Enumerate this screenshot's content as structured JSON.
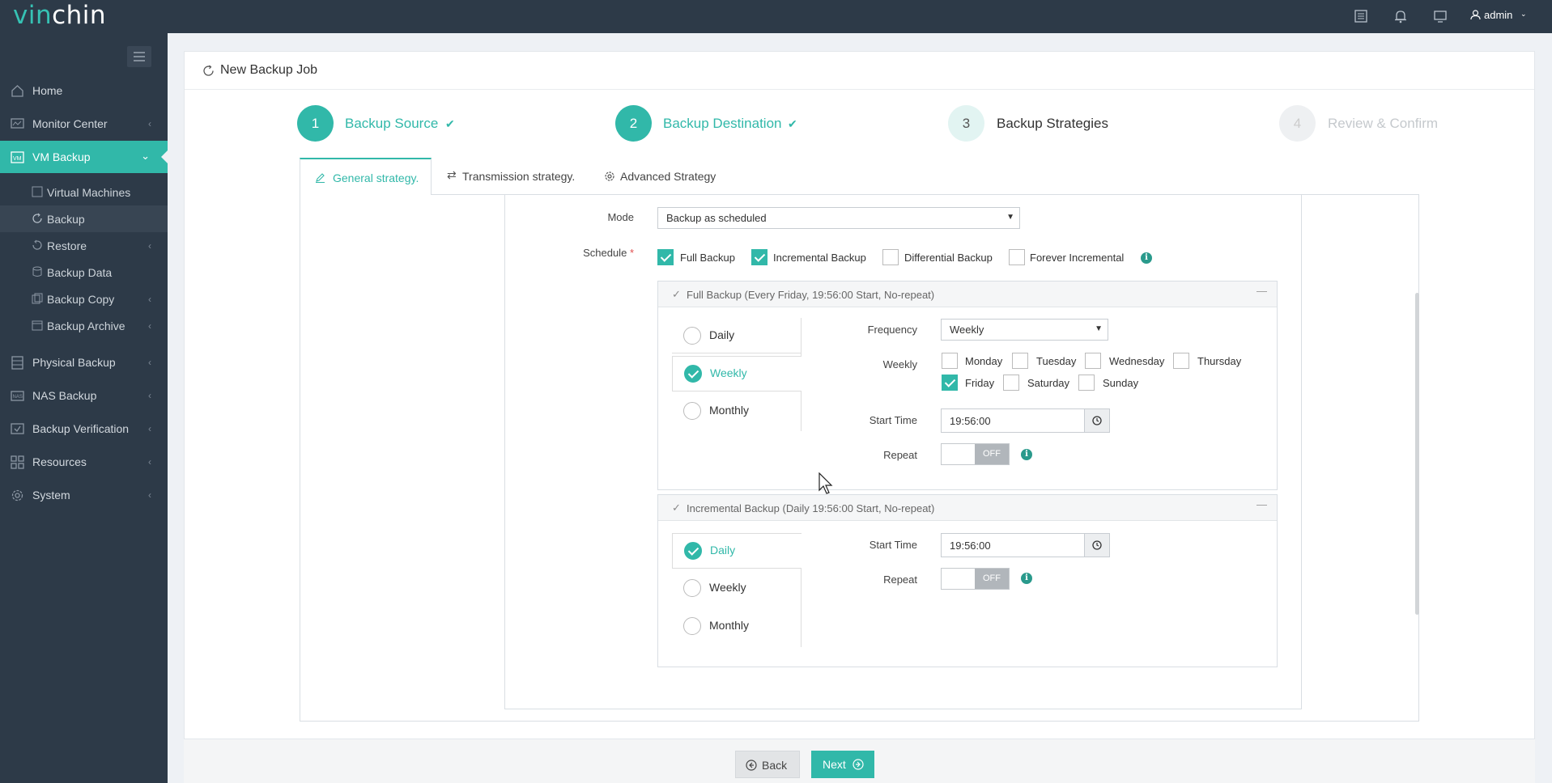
{
  "brand": {
    "logo_a": "vin",
    "logo_b": "chin"
  },
  "topbar": {
    "user": "admin"
  },
  "colors": {
    "accent": "#31b8a9",
    "sidebar": "#2d3a48"
  },
  "sidebar": {
    "items": [
      {
        "label": "Home",
        "icon": "home-icon"
      },
      {
        "label": "Monitor Center",
        "icon": "monitor-icon"
      },
      {
        "label": "VM Backup",
        "icon": "vm-icon"
      },
      {
        "label": "Physical Backup",
        "icon": "server-icon"
      },
      {
        "label": "NAS Backup",
        "icon": "nas-icon"
      },
      {
        "label": "Backup Verification",
        "icon": "verify-icon"
      },
      {
        "label": "Resources",
        "icon": "grid-icon"
      },
      {
        "label": "System",
        "icon": "gear-icon"
      }
    ],
    "sub": [
      {
        "label": "Virtual Machines"
      },
      {
        "label": "Backup"
      },
      {
        "label": "Restore"
      },
      {
        "label": "Backup Data"
      },
      {
        "label": "Backup Copy"
      },
      {
        "label": "Backup Archive"
      }
    ]
  },
  "page": {
    "title": "New Backup Job"
  },
  "steps": [
    {
      "num": "1",
      "label": "Backup Source"
    },
    {
      "num": "2",
      "label": "Backup Destination"
    },
    {
      "num": "3",
      "label": "Backup Strategies"
    },
    {
      "num": "4",
      "label": "Review & Confirm"
    }
  ],
  "tabs": [
    {
      "label": "General strategy."
    },
    {
      "label": "Transmission strategy."
    },
    {
      "label": "Advanced Strategy"
    }
  ],
  "form": {
    "mode_label": "Mode",
    "mode_value": "Backup as scheduled",
    "schedule_label": "Schedule",
    "schedule_required": "*",
    "schedule_options": [
      {
        "label": "Full Backup",
        "checked": true
      },
      {
        "label": "Incremental Backup",
        "checked": true
      },
      {
        "label": "Differential Backup",
        "checked": false
      },
      {
        "label": "Forever Incremental",
        "checked": false
      }
    ]
  },
  "full": {
    "header": "Full Backup (Every Friday, 19:56:00 Start, No-repeat)",
    "options": [
      "Daily",
      "Weekly",
      "Monthly"
    ],
    "selected": "Weekly",
    "frequency_label": "Frequency",
    "frequency_value": "Weekly",
    "weekly_label": "Weekly",
    "days": [
      {
        "label": "Monday",
        "checked": false
      },
      {
        "label": "Tuesday",
        "checked": false
      },
      {
        "label": "Wednesday",
        "checked": false
      },
      {
        "label": "Thursday",
        "checked": false
      },
      {
        "label": "Friday",
        "checked": true
      },
      {
        "label": "Saturday",
        "checked": false
      },
      {
        "label": "Sunday",
        "checked": false
      }
    ],
    "start_label": "Start Time",
    "start_value": "19:56:00",
    "repeat_label": "Repeat",
    "repeat_value": "OFF"
  },
  "incr": {
    "header": "Incremental Backup (Daily 19:56:00 Start, No-repeat)",
    "options": [
      "Daily",
      "Weekly",
      "Monthly"
    ],
    "selected": "Daily",
    "start_label": "Start Time",
    "start_value": "19:56:00",
    "repeat_label": "Repeat",
    "repeat_value": "OFF"
  },
  "footer": {
    "back": "Back",
    "next": "Next"
  }
}
